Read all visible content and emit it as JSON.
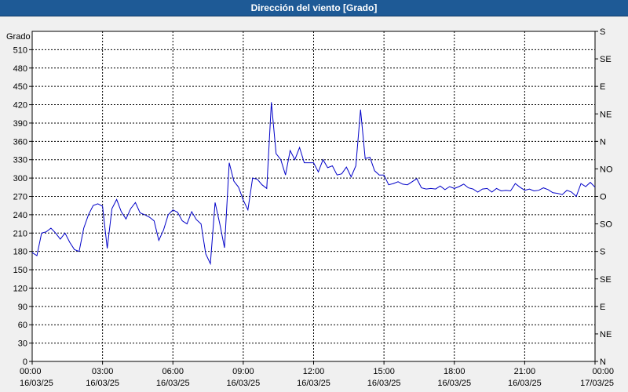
{
  "window": {
    "title": "Dirección del viento [Grado]"
  },
  "colors": {
    "titlebar": "#1e5a96",
    "series": "#0000c8",
    "grid": "#000000",
    "background": "#ffffff"
  },
  "chart_data": {
    "type": "line",
    "title": "Dirección del viento [Grado]",
    "ylabel": "Grado",
    "ylim": [
      0,
      540
    ],
    "yticks": [
      0,
      30,
      60,
      90,
      120,
      150,
      180,
      210,
      240,
      270,
      300,
      330,
      360,
      390,
      420,
      450,
      480,
      510
    ],
    "right_axis_labels": [
      "N",
      "NE",
      "E",
      "SE",
      "S",
      "SO",
      "O",
      "NO",
      "N",
      "NE",
      "E",
      "SE",
      "S"
    ],
    "xlim": [
      "16/03/25 00:00",
      "17/03/25 00:00"
    ],
    "xticks": [
      {
        "time": "00:00",
        "date": "16/03/25"
      },
      {
        "time": "03:00",
        "date": "16/03/25"
      },
      {
        "time": "06:00",
        "date": "16/03/25"
      },
      {
        "time": "09:00",
        "date": "16/03/25"
      },
      {
        "time": "12:00",
        "date": "16/03/25"
      },
      {
        "time": "15:00",
        "date": "16/03/25"
      },
      {
        "time": "18:00",
        "date": "16/03/25"
      },
      {
        "time": "21:00",
        "date": "16/03/25"
      },
      {
        "time": "00:00",
        "date": "17/03/25"
      }
    ],
    "grid": true,
    "series": [
      {
        "x_hours": [
          0.0,
          0.2,
          0.4,
          0.6,
          0.8,
          1.0,
          1.2,
          1.4,
          1.6,
          1.8,
          2.0,
          2.2,
          2.4,
          2.6,
          2.8,
          3.0,
          3.2,
          3.4,
          3.6,
          3.8,
          4.0,
          4.2,
          4.4,
          4.6,
          4.8,
          5.0,
          5.2,
          5.4,
          5.6,
          5.8,
          6.0,
          6.2,
          6.4,
          6.6,
          6.8,
          7.0,
          7.2,
          7.4,
          7.6,
          7.8,
          8.0,
          8.2,
          8.4,
          8.6,
          8.8,
          9.0,
          9.2,
          9.4,
          9.6,
          9.8,
          10.0,
          10.2,
          10.4,
          10.6,
          10.8,
          11.0,
          11.2,
          11.4,
          11.6,
          11.8,
          12.0,
          12.2,
          12.4,
          12.6,
          12.8,
          13.0,
          13.2,
          13.4,
          13.6,
          13.8,
          14.0,
          14.2,
          14.4,
          14.6,
          14.8,
          15.0,
          15.2,
          15.4,
          15.6,
          15.8,
          16.0,
          16.2,
          16.4,
          16.6,
          16.8,
          17.0,
          17.2,
          17.4,
          17.6,
          17.8,
          18.0,
          18.2,
          18.4,
          18.6,
          18.8,
          19.0,
          19.2,
          19.4,
          19.6,
          19.8,
          20.0,
          20.2,
          20.4,
          20.6,
          20.8,
          21.0,
          21.2,
          21.4,
          21.6,
          21.8,
          22.0,
          22.2,
          22.4,
          22.6,
          22.8,
          23.0,
          23.2,
          23.4,
          23.6,
          23.8,
          24.0
        ],
        "values": [
          178,
          173,
          210,
          212,
          218,
          210,
          200,
          210,
          195,
          183,
          180,
          218,
          240,
          255,
          258,
          254,
          185,
          250,
          265,
          245,
          233,
          250,
          260,
          243,
          240,
          236,
          230,
          198,
          215,
          240,
          248,
          244,
          230,
          225,
          245,
          232,
          225,
          176,
          160,
          260,
          225,
          186,
          325,
          295,
          285,
          264,
          248,
          300,
          298,
          289,
          283,
          424,
          340,
          330,
          305,
          345,
          330,
          350,
          325,
          325,
          325,
          310,
          330,
          317,
          320,
          305,
          307,
          318,
          302,
          320,
          412,
          332,
          334,
          312,
          305,
          305,
          289,
          291,
          294,
          290,
          289,
          294,
          299,
          284,
          282,
          283,
          282,
          287,
          281,
          286,
          283,
          286,
          290,
          284,
          282,
          277,
          282,
          283,
          277,
          283,
          279,
          280,
          279,
          291,
          285,
          280,
          282,
          279,
          280,
          284,
          281,
          276,
          275,
          273,
          280,
          277,
          270,
          291,
          286,
          293,
          285
        ],
        "color": "#0000c8"
      }
    ]
  }
}
